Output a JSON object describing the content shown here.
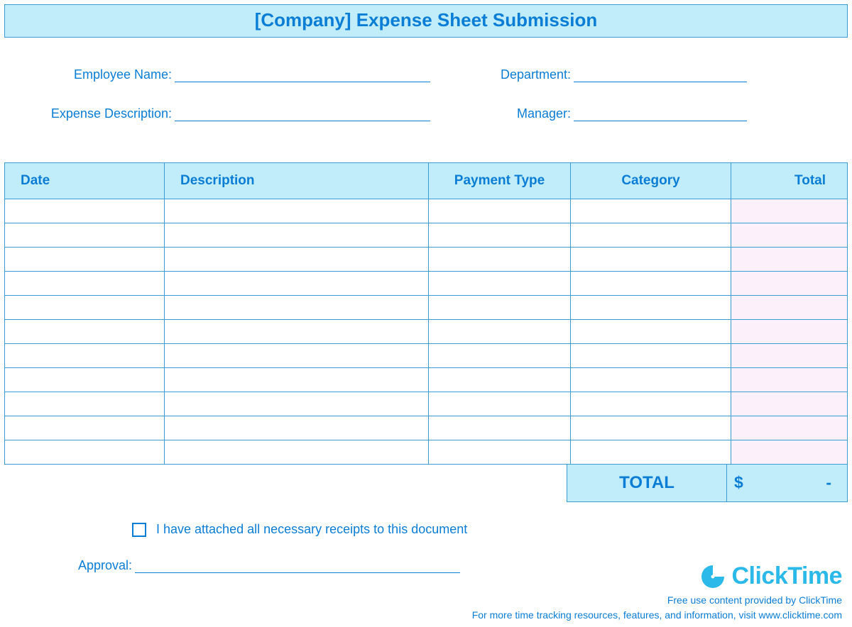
{
  "title": "[Company] Expense Sheet Submission",
  "fields": {
    "employee_name": {
      "label": "Employee Name:",
      "value": ""
    },
    "department": {
      "label": "Department:",
      "value": ""
    },
    "expense_description": {
      "label": "Expense Description:",
      "value": ""
    },
    "manager": {
      "label": "Manager:",
      "value": ""
    }
  },
  "table": {
    "headers": {
      "date": "Date",
      "description": "Description",
      "payment_type": "Payment Type",
      "category": "Category",
      "total": "Total"
    },
    "rows": [
      {
        "date": "",
        "description": "",
        "payment_type": "",
        "category": "",
        "total": ""
      },
      {
        "date": "",
        "description": "",
        "payment_type": "",
        "category": "",
        "total": ""
      },
      {
        "date": "",
        "description": "",
        "payment_type": "",
        "category": "",
        "total": ""
      },
      {
        "date": "",
        "description": "",
        "payment_type": "",
        "category": "",
        "total": ""
      },
      {
        "date": "",
        "description": "",
        "payment_type": "",
        "category": "",
        "total": ""
      },
      {
        "date": "",
        "description": "",
        "payment_type": "",
        "category": "",
        "total": ""
      },
      {
        "date": "",
        "description": "",
        "payment_type": "",
        "category": "",
        "total": ""
      },
      {
        "date": "",
        "description": "",
        "payment_type": "",
        "category": "",
        "total": ""
      },
      {
        "date": "",
        "description": "",
        "payment_type": "",
        "category": "",
        "total": ""
      },
      {
        "date": "",
        "description": "",
        "payment_type": "",
        "category": "",
        "total": ""
      },
      {
        "date": "",
        "description": "",
        "payment_type": "",
        "category": "",
        "total": ""
      }
    ]
  },
  "totals": {
    "label": "TOTAL",
    "currency": "$",
    "amount": "-"
  },
  "receipts": {
    "checked": false,
    "text": "I have attached all necessary receipts to this document"
  },
  "approval": {
    "label": "Approval:",
    "value": ""
  },
  "footer": {
    "logo_text": "ClickTime",
    "line1": "Free use content provided by ClickTime",
    "line2": "For more time tracking resources, features, and information, visit www.clicktime.com"
  }
}
